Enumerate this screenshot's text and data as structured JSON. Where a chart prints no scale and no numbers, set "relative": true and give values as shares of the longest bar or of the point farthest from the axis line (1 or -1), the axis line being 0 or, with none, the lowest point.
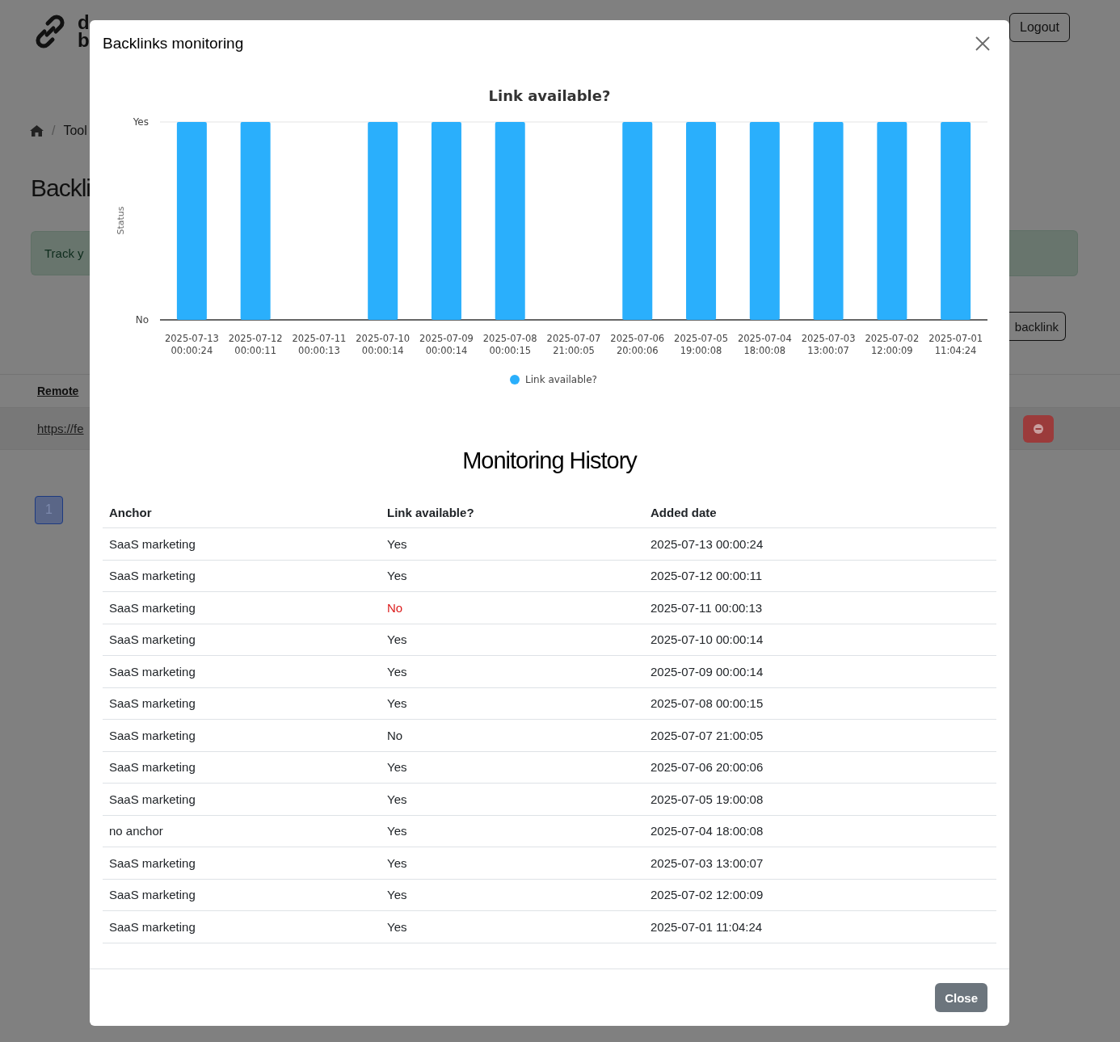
{
  "background_page": {
    "logo_lines": [
      "d",
      "b"
    ],
    "breadcrumb": {
      "separator": "/",
      "item": "Tool"
    },
    "page_title": "Backli",
    "alert": "Track y",
    "add_button": "backlink",
    "table_header": "Remote",
    "row_link": "https://fe",
    "pagination": [
      {
        "label": "1",
        "selected": true
      }
    ],
    "logout_button": "Logout"
  },
  "modal": {
    "title": "Backlinks monitoring",
    "chart_data": {
      "type": "bar",
      "title": "Link available?",
      "ylabel": "Status",
      "categories": [
        "2025-07-13 00:00:24",
        "2025-07-12 00:00:11",
        "2025-07-11 00:00:13",
        "2025-07-10 00:00:14",
        "2025-07-09 00:00:14",
        "2025-07-08 00:00:15",
        "2025-07-07 21:00:05",
        "2025-07-06 20:00:06",
        "2025-07-05 19:00:08",
        "2025-07-04 18:00:08",
        "2025-07-03 13:00:07",
        "2025-07-02 12:00:09",
        "2025-07-01 11:04:24"
      ],
      "series": [
        {
          "name": "Link available?",
          "color": "#2aaffc",
          "values": [
            1,
            1,
            0,
            1,
            1,
            1,
            0,
            1,
            1,
            1,
            1,
            1,
            1
          ]
        }
      ],
      "relative": true
    },
    "chart_y_axis_labels": [
      "Yes",
      "No"
    ],
    "history": {
      "title": "Monitoring History",
      "columns": [
        "Anchor",
        "Link available?",
        "Added date"
      ],
      "rows": [
        {
          "anchor": "SaaS marketing",
          "available": "Yes",
          "flagged": false,
          "added_date": "2025-07-13 00:00:24"
        },
        {
          "anchor": "SaaS marketing",
          "available": "Yes",
          "flagged": false,
          "added_date": "2025-07-12 00:00:11"
        },
        {
          "anchor": "SaaS marketing",
          "available": "No",
          "flagged": true,
          "added_date": "2025-07-11 00:00:13"
        },
        {
          "anchor": "SaaS marketing",
          "available": "Yes",
          "flagged": false,
          "added_date": "2025-07-10 00:00:14"
        },
        {
          "anchor": "SaaS marketing",
          "available": "Yes",
          "flagged": false,
          "added_date": "2025-07-09 00:00:14"
        },
        {
          "anchor": "SaaS marketing",
          "available": "Yes",
          "flagged": false,
          "added_date": "2025-07-08 00:00:15"
        },
        {
          "anchor": "SaaS marketing",
          "available": "No",
          "flagged": false,
          "added_date": "2025-07-07 21:00:05"
        },
        {
          "anchor": "SaaS marketing",
          "available": "Yes",
          "flagged": false,
          "added_date": "2025-07-06 20:00:06"
        },
        {
          "anchor": "SaaS marketing",
          "available": "Yes",
          "flagged": false,
          "added_date": "2025-07-05 19:00:08"
        },
        {
          "anchor": "no anchor",
          "available": "Yes",
          "flagged": false,
          "added_date": "2025-07-04 18:00:08"
        },
        {
          "anchor": "SaaS marketing",
          "available": "Yes",
          "flagged": false,
          "added_date": "2025-07-03 13:00:07"
        },
        {
          "anchor": "SaaS marketing",
          "available": "Yes",
          "flagged": false,
          "added_date": "2025-07-02 12:00:09"
        },
        {
          "anchor": "SaaS marketing",
          "available": "Yes",
          "flagged": false,
          "added_date": "2025-07-01 11:04:24"
        }
      ]
    },
    "close_button": "Close"
  }
}
